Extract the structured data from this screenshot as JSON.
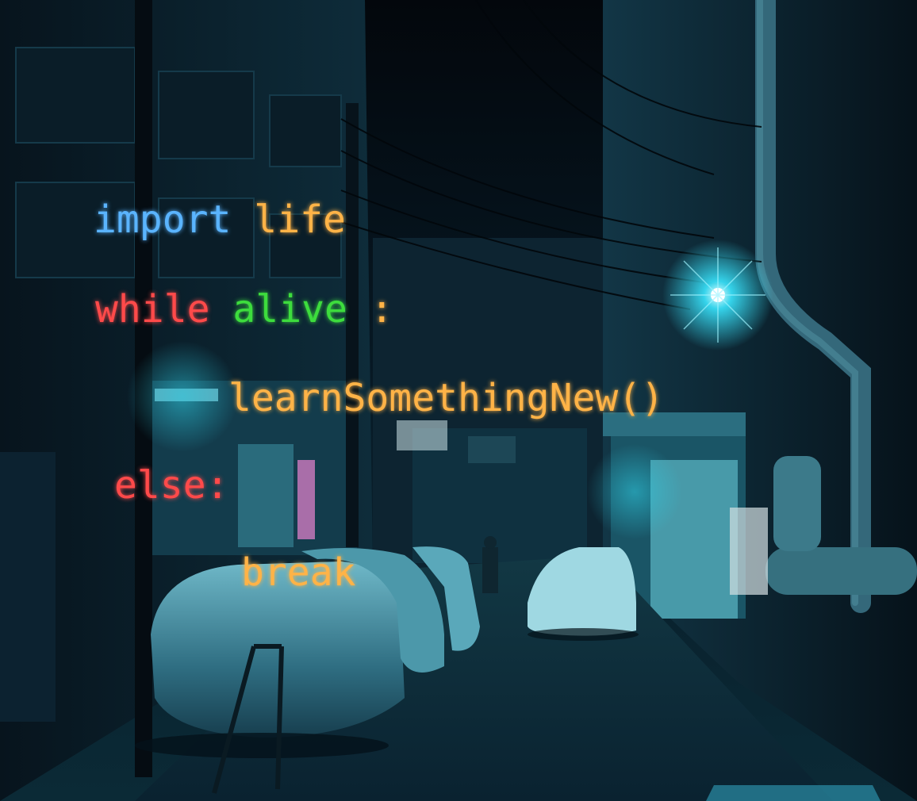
{
  "colors": {
    "blue": "#5ab4ff",
    "orange": "#ffb347",
    "red": "#ff4a4a",
    "green": "#3ddc3d",
    "teal_glow": "#39e6ff"
  },
  "code": {
    "line1": {
      "keyword": "import",
      "module": "life"
    },
    "line2": {
      "keyword": "while",
      "condition": "alive",
      "colon": ":"
    },
    "line3": {
      "call": "learnSomethingNew()"
    },
    "line4": {
      "keyword": "else:"
    },
    "line5": {
      "statement": "break"
    }
  }
}
